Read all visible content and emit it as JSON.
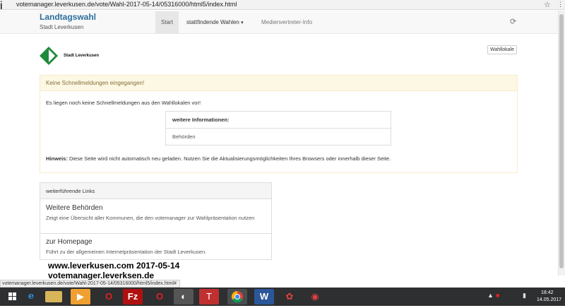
{
  "browser": {
    "url": "votemanager.leverkusen.de/vote/Wahl-2017-05-14/05316000/html5/index.html",
    "status_url": "votemanager.leverkusen.de/vote/Wahl-2017-05-14/05316000/html5/index.html#"
  },
  "brand": {
    "title": "Landtagswahl",
    "subtitle": "Stadt Leverkusen"
  },
  "nav": {
    "start": "Start",
    "elections": "stattfindende Wahlen",
    "media": "Medienvertreter-Info"
  },
  "logo": {
    "text": "Stadt Leverkusen"
  },
  "buttons": {
    "wahllokale": "Wahllokale"
  },
  "warning_panel": {
    "title": "Keine Schnellmeldungen eingegangen!",
    "message": "Es liegen noch keine Schnellmeldungen aus den Wahllokalen vor!",
    "info_title": "weitere Informationen:",
    "info_item": "Behörden",
    "hint_label": "Hinweis:",
    "hint_text": "Diese Seite wird nicht automatisch neu geladen. Nutzen Sie die Aktualisierungsmöglichkeiten Ihres Browsers oder innerhalb dieser Seite."
  },
  "links_panel": {
    "title": "weiterführende Links",
    "items": [
      {
        "title": "Weitere Behörden",
        "desc": "Zeigt eine Übersicht aller Kommunen, die den votemanager zur Wahlpräsentation nutzen"
      },
      {
        "title": "zur Homepage",
        "desc": "Führt zu der allgemeinen Internetpräsentation der Stadt Leverkusen."
      }
    ]
  },
  "overlay": {
    "line1": "www.leverkusen.com  2017-05-14",
    "line2": "votemanager.leverksen.de"
  },
  "taskbar": {
    "time": "18:42",
    "date": "14.05.2017",
    "icons": [
      "start-icon",
      "ie-icon",
      "explorer-icon",
      "media-icon",
      "opera-icon",
      "filezilla-icon",
      "opera-icon",
      "tool-icon",
      "app-icon",
      "chrome-icon",
      "word-icon",
      "app-icon",
      "app-icon"
    ]
  },
  "colors": {
    "brand": "#2a6e9b",
    "warning_bg": "#fcf8e3",
    "warning_text": "#8a6d3b",
    "logo_green": "#1f8a3a"
  }
}
